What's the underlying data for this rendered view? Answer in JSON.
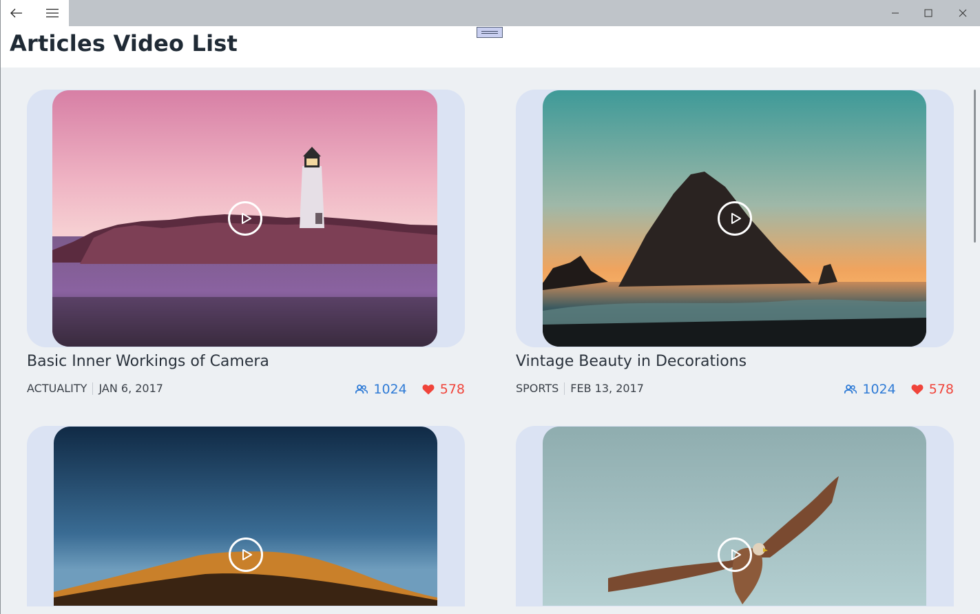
{
  "window": {
    "title": "Articles Video List",
    "controls": [
      "back-icon",
      "hamburger-icon",
      "minimize-icon",
      "maximize-icon",
      "close-icon"
    ]
  },
  "colors": {
    "views": "#2f7bd6",
    "likes": "#f0443a",
    "card_background": "#dbe3f3",
    "page_background": "#edf0f3"
  },
  "articles": [
    {
      "title": "Basic Inner Workings of Camera",
      "category": "ACTUALITY",
      "date": "JAN 6, 2017",
      "views": "1024",
      "likes": "578",
      "image": "lighthouse-at-dusk"
    },
    {
      "title": "Vintage Beauty in Decorations",
      "category": "SPORTS",
      "date": "FEB 13, 2017",
      "views": "1024",
      "likes": "578",
      "image": "sea-rock-sunset"
    },
    {
      "title": "",
      "category": "",
      "date": "",
      "views": "",
      "likes": "",
      "image": "desert-dune-night"
    },
    {
      "title": "",
      "category": "",
      "date": "",
      "views": "",
      "likes": "",
      "image": "hawk-in-flight"
    }
  ]
}
